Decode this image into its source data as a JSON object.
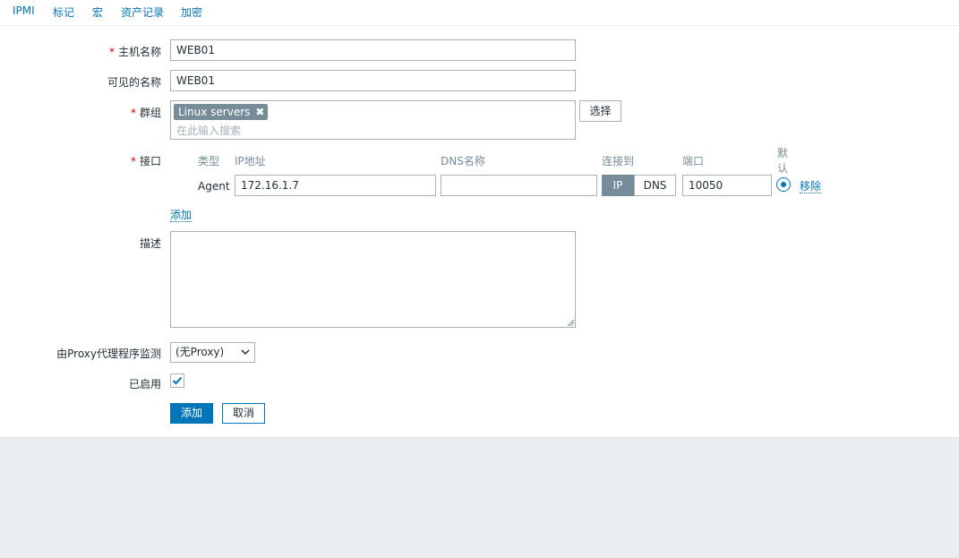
{
  "tabs": [
    "IPMI",
    "标记",
    "宏",
    "资产记录",
    "加密"
  ],
  "form": {
    "host_name_label": "主机名称",
    "host_name_value": "WEB01",
    "visible_name_label": "可见的名称",
    "visible_name_value": "WEB01",
    "groups_label": "群组",
    "group_chip": "Linux servers",
    "group_search_placeholder": "在此输入搜索",
    "select_button": "选择",
    "interfaces_label": "接口",
    "interface_headers": {
      "type": "类型",
      "ip": "IP地址",
      "dns": "DNS名称",
      "connect": "连接到",
      "port": "端口",
      "default_line1": "默",
      "default_line2": "认"
    },
    "interface_row": {
      "type": "Agent",
      "ip": "172.16.1.7",
      "dns": "",
      "connect_ip": "IP",
      "connect_dns": "DNS",
      "connect_selected": "IP",
      "port": "10050",
      "default_selected": true,
      "remove_link": "移除"
    },
    "add_interface_link": "添加",
    "description_label": "描述",
    "description_value": "",
    "proxy_label": "由Proxy代理程序监测",
    "proxy_value": "(无Proxy)",
    "enabled_label": "已启用",
    "enabled_checked": true,
    "add_button": "添加",
    "cancel_button": "取消"
  },
  "colors": {
    "accent": "#0275b8",
    "required": "#d40000",
    "chip": "#768d99",
    "page_bg": "#ebeef0"
  }
}
